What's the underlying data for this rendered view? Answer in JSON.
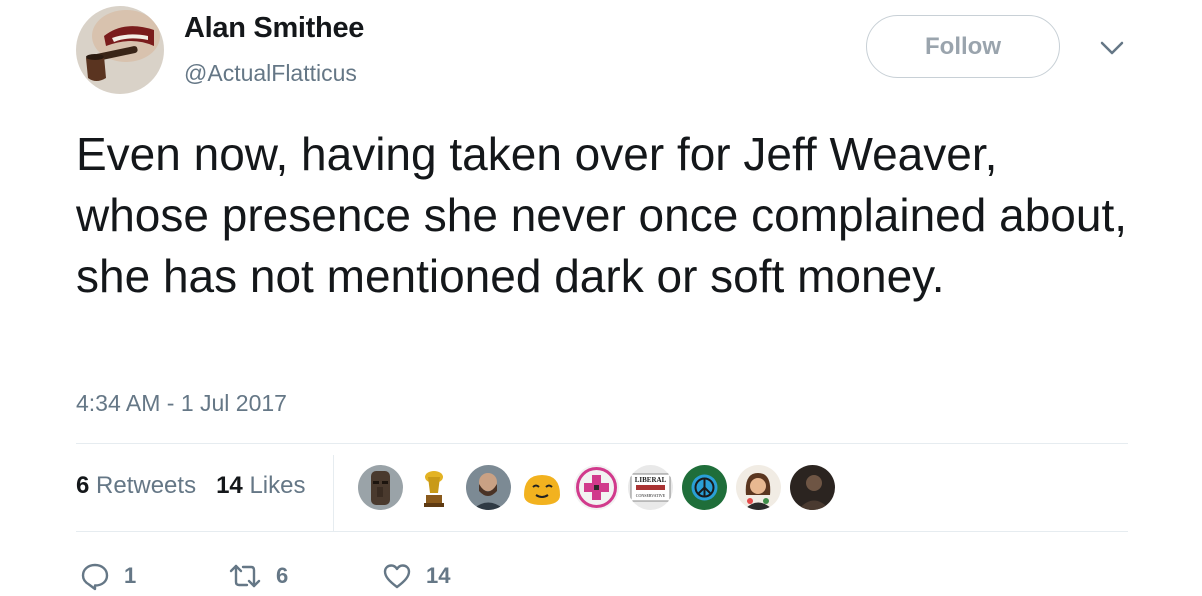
{
  "user": {
    "display_name": "Alan Smithee",
    "handle": "@ActualFlatticus"
  },
  "follow_label": "Follow",
  "tweet": {
    "text": "Even now, having taken over for Jeff Weaver, whose presence she never once complained about, she has not mentioned dark or soft money.",
    "timestamp": "4:34 AM - 1 Jul 2017"
  },
  "stats": {
    "retweets_count": "6",
    "retweets_label": "Retweets",
    "likes_count": "14",
    "likes_label": "Likes"
  },
  "liker_avatars": [
    {
      "icon": "moai-statue-avatar"
    },
    {
      "icon": "golden-trophy-avatar"
    },
    {
      "icon": "bearded-man-avatar"
    },
    {
      "icon": "cartoon-face-avatar"
    },
    {
      "icon": "pink-cross-avatar"
    },
    {
      "icon": "liberal-conservative-sign-avatar",
      "label_top": "LIBERAL",
      "label_bottom": "CONSERVATIVE"
    },
    {
      "icon": "peace-sign-avatar"
    },
    {
      "icon": "illustrated-woman-avatar"
    },
    {
      "icon": "dark-photo-avatar"
    }
  ],
  "actions": {
    "reply_count": "1",
    "retweet_count": "6",
    "like_count": "14"
  },
  "colors": {
    "text_primary": "#14171a",
    "text_secondary": "#657786",
    "border": "#e6ecf0"
  }
}
